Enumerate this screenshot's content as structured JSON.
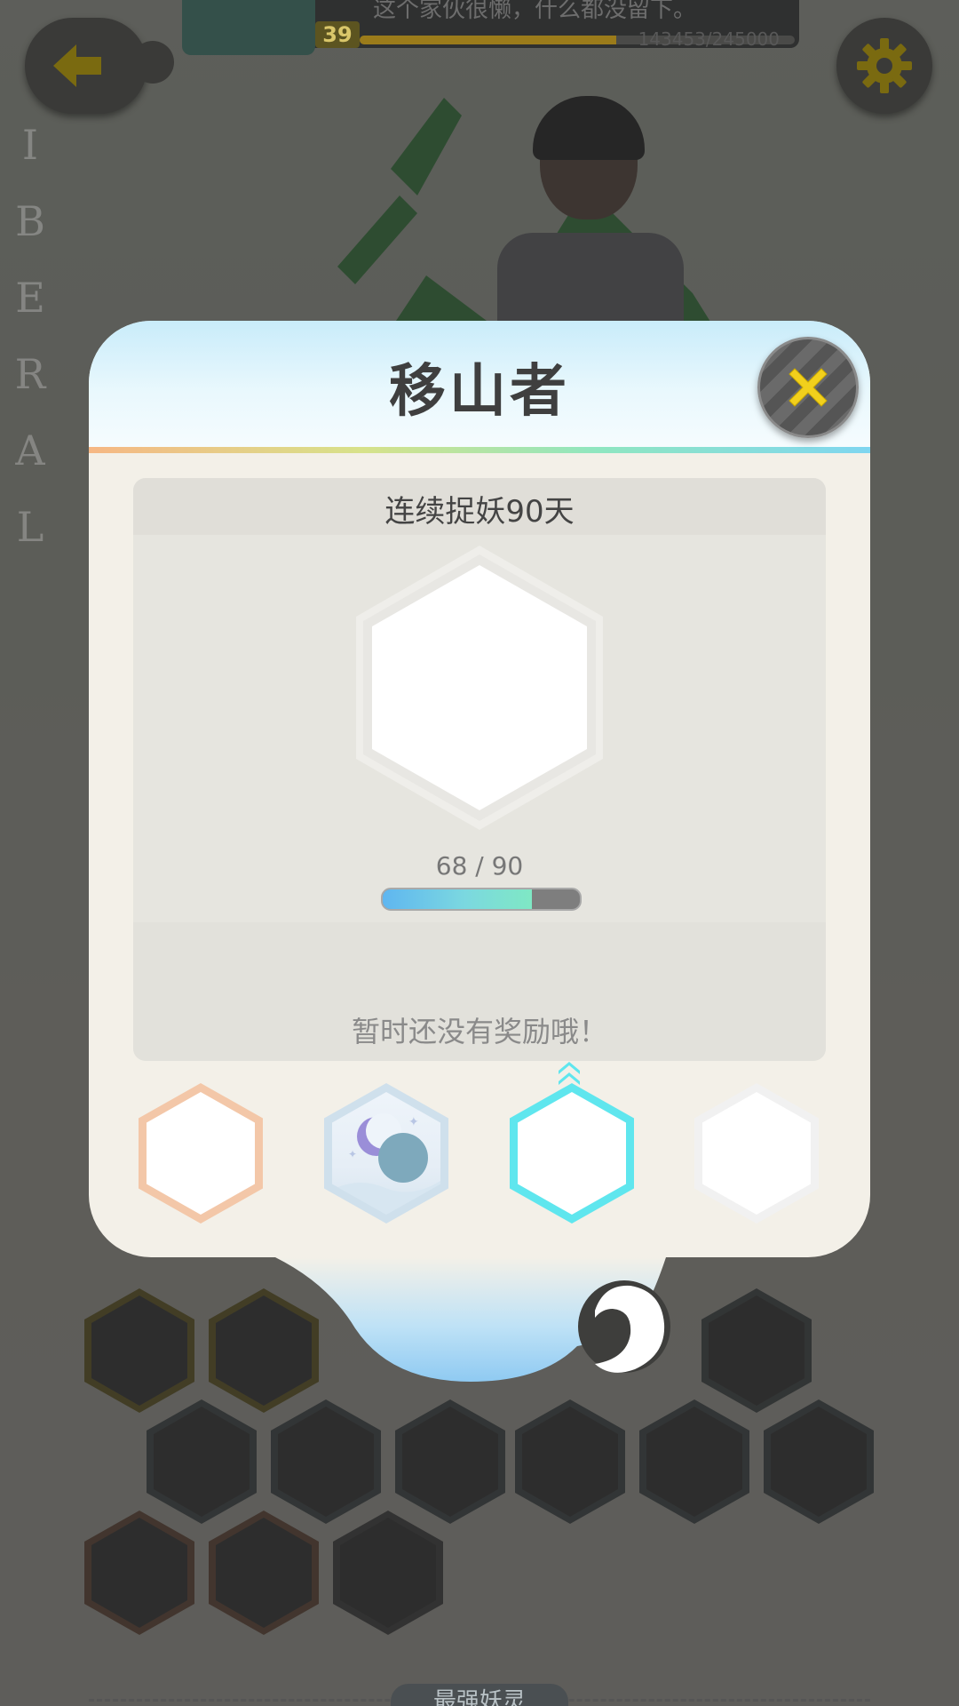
{
  "hud": {
    "level": "39",
    "message": "这个家伙很懒，什么都没留下。",
    "exp_text": "143453/245000",
    "exp_progress": 0.59
  },
  "background": {
    "vertical_text": [
      "I",
      "B",
      "E",
      "R",
      "A",
      "L"
    ],
    "bottom_tab": "最强妖灵"
  },
  "modal": {
    "title": "移山者",
    "condition": "连续捉妖90天",
    "progress_text": "68 / 90",
    "progress_value": 68,
    "progress_max": 90,
    "reward_text": "暂时还没有奖励哦！",
    "tiers": [
      {
        "name": "tier-bronze",
        "color": "#f3c7a8",
        "state": "locked"
      },
      {
        "name": "tier-moon",
        "color": "#cfe0ec",
        "state": "unlocked"
      },
      {
        "name": "tier-cyan",
        "color": "#5fe6ee",
        "state": "current"
      },
      {
        "name": "tier-white",
        "color": "#f1f1f1",
        "state": "locked"
      }
    ]
  },
  "colors": {
    "accent_yellow": "#f2d01c",
    "progress_start": "#5fb6f0",
    "progress_end": "#7fe8c4"
  },
  "icons": [
    "back-arrow-icon",
    "gear-icon",
    "close-x-icon",
    "up-chevron-icon",
    "moon-icon"
  ]
}
